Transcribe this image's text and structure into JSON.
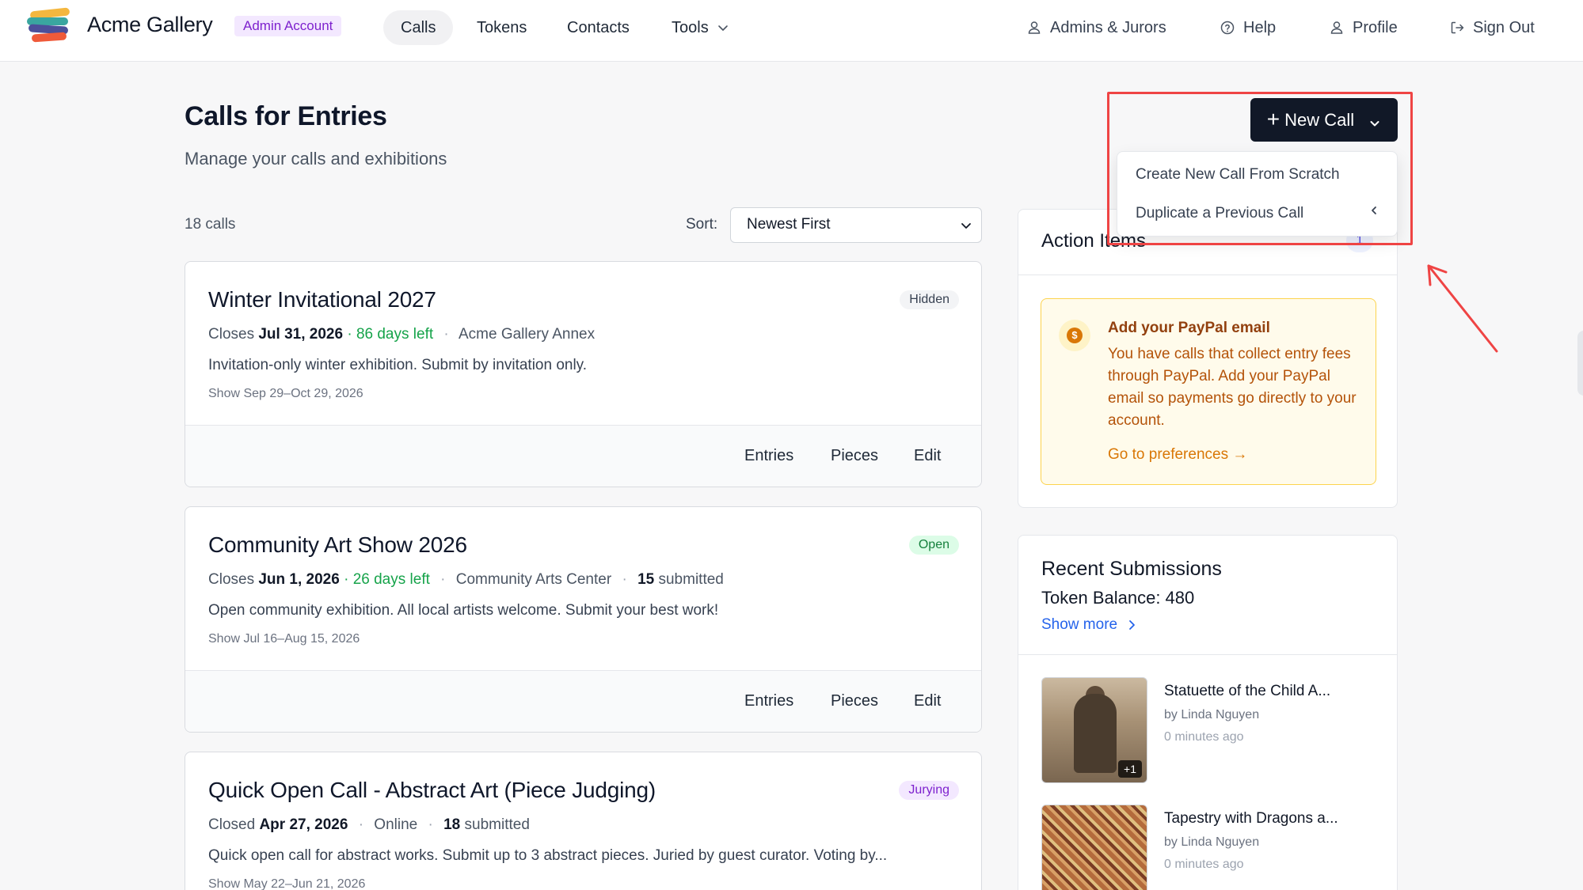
{
  "app": {
    "name": "Acme Gallery",
    "account_badge": "Admin Account"
  },
  "nav": {
    "items": [
      {
        "label": "Calls",
        "active": true
      },
      {
        "label": "Tokens"
      },
      {
        "label": "Contacts"
      },
      {
        "label": "Tools"
      }
    ],
    "right": [
      {
        "label": "Admins & Jurors",
        "icon": "user-icon"
      },
      {
        "label": "Help",
        "icon": "help-circle-icon"
      },
      {
        "label": "Profile",
        "icon": "user-icon"
      },
      {
        "label": "Sign Out",
        "icon": "sign-out-icon"
      }
    ]
  },
  "header": {
    "title": "Calls for Entries",
    "subtitle": "Manage your calls and exhibitions",
    "new_call_label": "New Call"
  },
  "dropdown": {
    "items": [
      "Create New Call From Scratch",
      "Duplicate a Previous Call"
    ]
  },
  "list": {
    "count_label": "18 calls",
    "sort_label": "Sort:",
    "sort_value": "Newest First"
  },
  "calls": [
    {
      "title": "Winter Invitational 2027",
      "status": "Hidden",
      "close_prefix": "Closes",
      "close_date": "Jul 31, 2026",
      "days_left": "· 86 days left",
      "venue": "Acme Gallery Annex",
      "submitted_count": "",
      "submitted_label": "",
      "description": "Invitation-only winter exhibition. Submit by invitation only.",
      "show_dates": "Show Sep 29–Oct 29, 2026",
      "actions": [
        "Entries",
        "Pieces",
        "Edit"
      ]
    },
    {
      "title": "Community Art Show 2026",
      "status": "Open",
      "close_prefix": "Closes",
      "close_date": "Jun 1, 2026",
      "days_left": "· 26 days left",
      "venue": "Community Arts Center",
      "submitted_count": "15",
      "submitted_label": "submitted",
      "description": "Open community exhibition. All local artists welcome. Submit your best work!",
      "show_dates": "Show Jul 16–Aug 15, 2026",
      "actions": [
        "Entries",
        "Pieces",
        "Edit"
      ]
    },
    {
      "title": "Quick Open Call - Abstract Art (Piece Judging)",
      "status": "Jurying",
      "close_prefix": "Closed",
      "close_date": "Apr 27, 2026",
      "days_left": "",
      "venue": "Online",
      "submitted_count": "18",
      "submitted_label": "submitted",
      "description": "Quick open call for abstract works. Submit up to 3 abstract pieces. Juried by guest curator. Voting by...",
      "show_dates": "Show May 22–Jun 21, 2026",
      "actions": []
    }
  ],
  "action_items": {
    "title": "Action Items",
    "badge": "1",
    "alert_title": "Add your PayPal email",
    "alert_text": "You have calls that collect entry fees through PayPal. Add your PayPal email so payments go directly to your account.",
    "alert_link": "Go to preferences →"
  },
  "recent": {
    "title": "Recent Submissions",
    "balance": "Token Balance: 480",
    "show_more": "Show more",
    "items": [
      {
        "title": "Statuette of the Child A...",
        "by": "by Linda Nguyen",
        "time": "0 minutes ago",
        "extra": "+1"
      },
      {
        "title": "Tapestry with Dragons a...",
        "by": "by Linda Nguyen",
        "time": "0 minutes ago"
      }
    ]
  },
  "colors": {
    "accent_dark": "#111827",
    "highlight": "#ef4444",
    "link_blue": "#2563eb",
    "open_green": "#16a34a"
  }
}
